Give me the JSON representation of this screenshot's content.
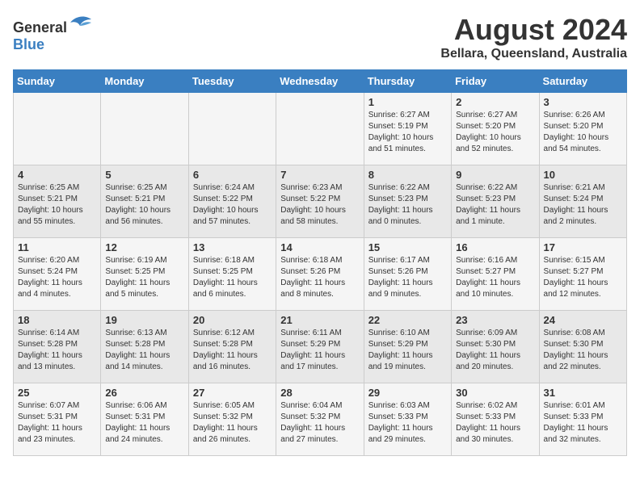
{
  "header": {
    "logo_general": "General",
    "logo_blue": "Blue",
    "month_year": "August 2024",
    "location": "Bellara, Queensland, Australia"
  },
  "weekdays": [
    "Sunday",
    "Monday",
    "Tuesday",
    "Wednesday",
    "Thursday",
    "Friday",
    "Saturday"
  ],
  "weeks": [
    [
      {
        "day": "",
        "sunrise": "",
        "sunset": "",
        "daylight": ""
      },
      {
        "day": "",
        "sunrise": "",
        "sunset": "",
        "daylight": ""
      },
      {
        "day": "",
        "sunrise": "",
        "sunset": "",
        "daylight": ""
      },
      {
        "day": "",
        "sunrise": "",
        "sunset": "",
        "daylight": ""
      },
      {
        "day": "1",
        "sunrise": "Sunrise: 6:27 AM",
        "sunset": "Sunset: 5:19 PM",
        "daylight": "Daylight: 10 hours and 51 minutes."
      },
      {
        "day": "2",
        "sunrise": "Sunrise: 6:27 AM",
        "sunset": "Sunset: 5:20 PM",
        "daylight": "Daylight: 10 hours and 52 minutes."
      },
      {
        "day": "3",
        "sunrise": "Sunrise: 6:26 AM",
        "sunset": "Sunset: 5:20 PM",
        "daylight": "Daylight: 10 hours and 54 minutes."
      }
    ],
    [
      {
        "day": "4",
        "sunrise": "Sunrise: 6:25 AM",
        "sunset": "Sunset: 5:21 PM",
        "daylight": "Daylight: 10 hours and 55 minutes."
      },
      {
        "day": "5",
        "sunrise": "Sunrise: 6:25 AM",
        "sunset": "Sunset: 5:21 PM",
        "daylight": "Daylight: 10 hours and 56 minutes."
      },
      {
        "day": "6",
        "sunrise": "Sunrise: 6:24 AM",
        "sunset": "Sunset: 5:22 PM",
        "daylight": "Daylight: 10 hours and 57 minutes."
      },
      {
        "day": "7",
        "sunrise": "Sunrise: 6:23 AM",
        "sunset": "Sunset: 5:22 PM",
        "daylight": "Daylight: 10 hours and 58 minutes."
      },
      {
        "day": "8",
        "sunrise": "Sunrise: 6:22 AM",
        "sunset": "Sunset: 5:23 PM",
        "daylight": "Daylight: 11 hours and 0 minutes."
      },
      {
        "day": "9",
        "sunrise": "Sunrise: 6:22 AM",
        "sunset": "Sunset: 5:23 PM",
        "daylight": "Daylight: 11 hours and 1 minute."
      },
      {
        "day": "10",
        "sunrise": "Sunrise: 6:21 AM",
        "sunset": "Sunset: 5:24 PM",
        "daylight": "Daylight: 11 hours and 2 minutes."
      }
    ],
    [
      {
        "day": "11",
        "sunrise": "Sunrise: 6:20 AM",
        "sunset": "Sunset: 5:24 PM",
        "daylight": "Daylight: 11 hours and 4 minutes."
      },
      {
        "day": "12",
        "sunrise": "Sunrise: 6:19 AM",
        "sunset": "Sunset: 5:25 PM",
        "daylight": "Daylight: 11 hours and 5 minutes."
      },
      {
        "day": "13",
        "sunrise": "Sunrise: 6:18 AM",
        "sunset": "Sunset: 5:25 PM",
        "daylight": "Daylight: 11 hours and 6 minutes."
      },
      {
        "day": "14",
        "sunrise": "Sunrise: 6:18 AM",
        "sunset": "Sunset: 5:26 PM",
        "daylight": "Daylight: 11 hours and 8 minutes."
      },
      {
        "day": "15",
        "sunrise": "Sunrise: 6:17 AM",
        "sunset": "Sunset: 5:26 PM",
        "daylight": "Daylight: 11 hours and 9 minutes."
      },
      {
        "day": "16",
        "sunrise": "Sunrise: 6:16 AM",
        "sunset": "Sunset: 5:27 PM",
        "daylight": "Daylight: 11 hours and 10 minutes."
      },
      {
        "day": "17",
        "sunrise": "Sunrise: 6:15 AM",
        "sunset": "Sunset: 5:27 PM",
        "daylight": "Daylight: 11 hours and 12 minutes."
      }
    ],
    [
      {
        "day": "18",
        "sunrise": "Sunrise: 6:14 AM",
        "sunset": "Sunset: 5:28 PM",
        "daylight": "Daylight: 11 hours and 13 minutes."
      },
      {
        "day": "19",
        "sunrise": "Sunrise: 6:13 AM",
        "sunset": "Sunset: 5:28 PM",
        "daylight": "Daylight: 11 hours and 14 minutes."
      },
      {
        "day": "20",
        "sunrise": "Sunrise: 6:12 AM",
        "sunset": "Sunset: 5:28 PM",
        "daylight": "Daylight: 11 hours and 16 minutes."
      },
      {
        "day": "21",
        "sunrise": "Sunrise: 6:11 AM",
        "sunset": "Sunset: 5:29 PM",
        "daylight": "Daylight: 11 hours and 17 minutes."
      },
      {
        "day": "22",
        "sunrise": "Sunrise: 6:10 AM",
        "sunset": "Sunset: 5:29 PM",
        "daylight": "Daylight: 11 hours and 19 minutes."
      },
      {
        "day": "23",
        "sunrise": "Sunrise: 6:09 AM",
        "sunset": "Sunset: 5:30 PM",
        "daylight": "Daylight: 11 hours and 20 minutes."
      },
      {
        "day": "24",
        "sunrise": "Sunrise: 6:08 AM",
        "sunset": "Sunset: 5:30 PM",
        "daylight": "Daylight: 11 hours and 22 minutes."
      }
    ],
    [
      {
        "day": "25",
        "sunrise": "Sunrise: 6:07 AM",
        "sunset": "Sunset: 5:31 PM",
        "daylight": "Daylight: 11 hours and 23 minutes."
      },
      {
        "day": "26",
        "sunrise": "Sunrise: 6:06 AM",
        "sunset": "Sunset: 5:31 PM",
        "daylight": "Daylight: 11 hours and 24 minutes."
      },
      {
        "day": "27",
        "sunrise": "Sunrise: 6:05 AM",
        "sunset": "Sunset: 5:32 PM",
        "daylight": "Daylight: 11 hours and 26 minutes."
      },
      {
        "day": "28",
        "sunrise": "Sunrise: 6:04 AM",
        "sunset": "Sunset: 5:32 PM",
        "daylight": "Daylight: 11 hours and 27 minutes."
      },
      {
        "day": "29",
        "sunrise": "Sunrise: 6:03 AM",
        "sunset": "Sunset: 5:33 PM",
        "daylight": "Daylight: 11 hours and 29 minutes."
      },
      {
        "day": "30",
        "sunrise": "Sunrise: 6:02 AM",
        "sunset": "Sunset: 5:33 PM",
        "daylight": "Daylight: 11 hours and 30 minutes."
      },
      {
        "day": "31",
        "sunrise": "Sunrise: 6:01 AM",
        "sunset": "Sunset: 5:33 PM",
        "daylight": "Daylight: 11 hours and 32 minutes."
      }
    ]
  ]
}
